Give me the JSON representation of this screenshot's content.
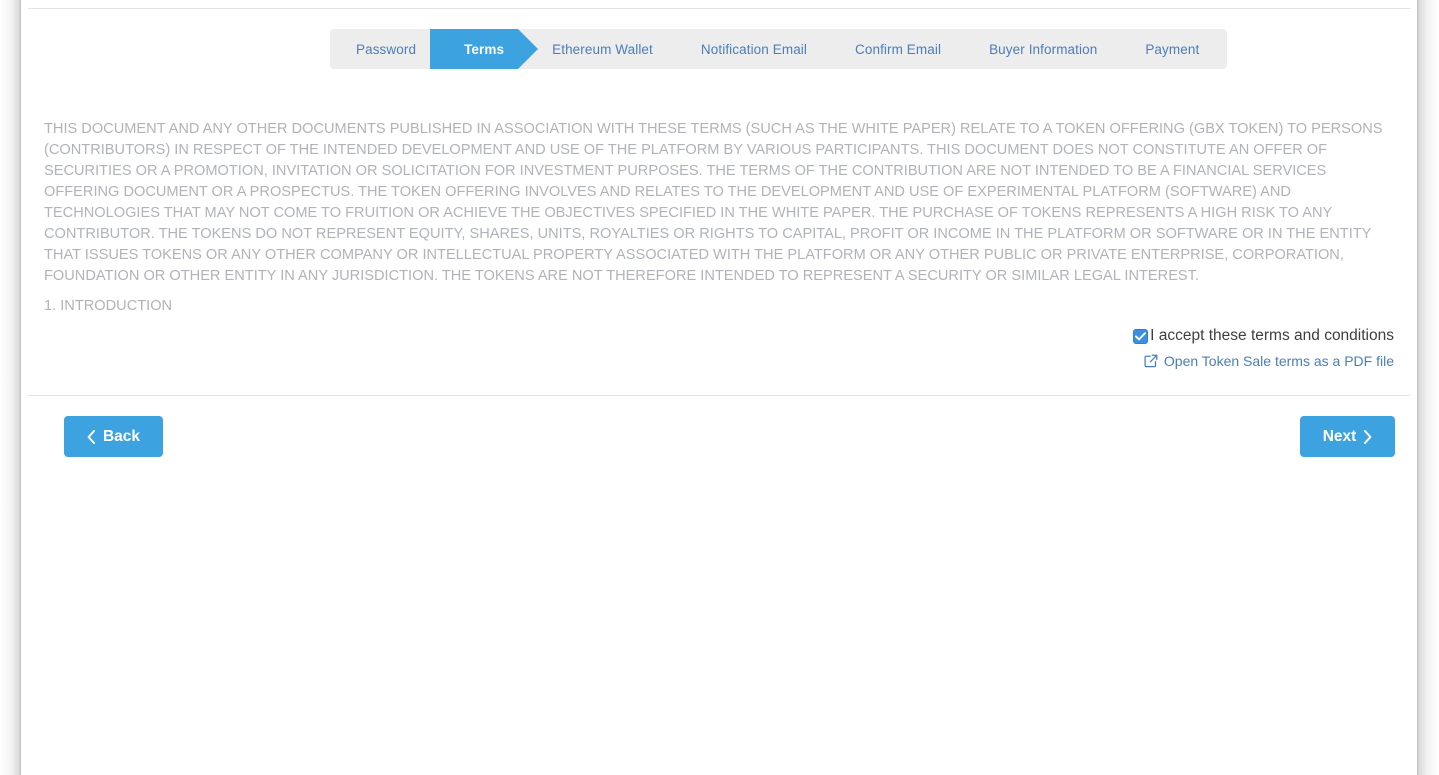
{
  "steps": [
    {
      "label": "Password",
      "state": "done"
    },
    {
      "label": "Terms",
      "state": "active"
    },
    {
      "label": "Ethereum Wallet",
      "state": "upcoming"
    },
    {
      "label": "Notification Email",
      "state": "upcoming"
    },
    {
      "label": "Confirm Email",
      "state": "upcoming"
    },
    {
      "label": "Buyer Information",
      "state": "upcoming"
    },
    {
      "label": "Payment",
      "state": "upcoming"
    }
  ],
  "legal": {
    "disclaimer": "THIS DOCUMENT AND ANY OTHER DOCUMENTS PUBLISHED IN ASSOCIATION WITH THESE TERMS (SUCH AS THE WHITE PAPER) RELATE TO A TOKEN OFFERING (GBX TOKEN) TO PERSONS (CONTRIBUTORS) IN RESPECT OF THE INTENDED DEVELOPMENT AND USE OF THE PLATFORM BY VARIOUS PARTICIPANTS. THIS DOCUMENT DOES NOT CONSTITUTE AN OFFER OF SECURITIES OR A PROMOTION, INVITATION OR SOLICITATION FOR INVESTMENT PURPOSES. THE TERMS OF THE CONTRIBUTION ARE NOT INTENDED TO BE A FINANCIAL SERVICES OFFERING DOCUMENT OR A PROSPECTUS. THE TOKEN OFFERING INVOLVES AND RELATES TO THE DEVELOPMENT AND USE OF EXPERIMENTAL PLATFORM (SOFTWARE) AND TECHNOLOGIES THAT MAY NOT COME TO FRUITION OR ACHIEVE THE OBJECTIVES SPECIFIED IN THE WHITE PAPER. THE PURCHASE OF TOKENS REPRESENTS A HIGH RISK TO ANY CONTRIBUTOR. THE TOKENS DO NOT REPRESENT EQUITY, SHARES, UNITS, ROYALTIES OR RIGHTS TO CAPITAL, PROFIT OR INCOME IN THE PLATFORM OR SOFTWARE OR IN THE ENTITY THAT ISSUES TOKENS OR ANY OTHER COMPANY OR INTELLECTUAL PROPERTY ASSOCIATED WITH THE PLATFORM OR ANY OTHER PUBLIC OR PRIVATE ENTERPRISE, CORPORATION, FOUNDATION OR OTHER ENTITY IN ANY JURISDICTION. THE TOKENS ARE NOT THEREFORE INTENDED TO REPRESENT A SECURITY OR SIMILAR LEGAL INTEREST.",
    "section_heading": "1. INTRODUCTION"
  },
  "accept": {
    "label": "I accept these terms and conditions",
    "checked": true,
    "pdf_link_label": "Open Token Sale terms as a PDF file",
    "pdf_icon": "external-link-icon",
    "check_icon": "checkmark-icon"
  },
  "nav": {
    "back_label": "Back",
    "next_label": "Next",
    "back_icon": "chevron-left-icon",
    "next_icon": "chevron-right-icon"
  },
  "colors": {
    "accent": "#3ca2e0",
    "checkbox": "#3b8fe0",
    "link": "#4a7ebb",
    "step_inactive_bg": "#ededed",
    "legal_text": "#b0b3b8"
  }
}
